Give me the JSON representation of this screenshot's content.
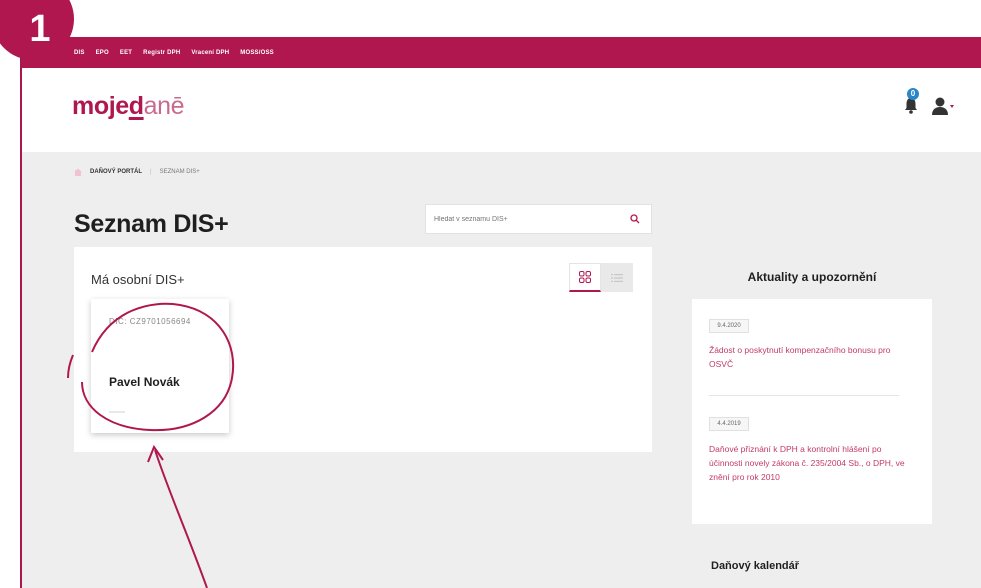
{
  "step_number": "1",
  "topbar": {
    "items": [
      "DIS",
      "EPO",
      "EET",
      "Registr DPH",
      "Vracení DPH",
      "MOSS/OSS"
    ]
  },
  "header": {
    "logo_part1": "moje",
    "logo_part2": "d",
    "logo_part3": "anē",
    "notification_count": "0"
  },
  "breadcrumb": {
    "home": "DAŇOVÝ PORTÁL",
    "separator": "|",
    "current": "SEZNAM DIS+"
  },
  "page_title": "Seznam DIS+",
  "search": {
    "placeholder": "Hledat v seznamu DIS+"
  },
  "panel": {
    "title": "Má osobní DIS+",
    "card": {
      "dic": "DIČ: CZ9701056694",
      "name": "Pavel Novák"
    }
  },
  "news": {
    "title": "Aktuality a upozornění",
    "items": [
      {
        "date": "9.4.2020",
        "text": "Žádost o poskytnutí kompenzačního bonusu pro OSVČ"
      },
      {
        "date": "4.4.2019",
        "text": "Daňové přiznání k DPH a kontrolní hlášení po účinnosti novely zákona č. 235/2004 Sb., o DPH, ve znění pro rok 2010"
      }
    ]
  },
  "calendar": {
    "title": "Daňový kalendář"
  },
  "colors": {
    "brand": "#b0174e",
    "link": "#c23a6a",
    "notification": "#2a86c8",
    "content_bg": "#eeeeee"
  },
  "icons": [
    "home-icon",
    "search-icon",
    "grid-view-icon",
    "list-view-icon",
    "bell-icon",
    "user-icon",
    "caret-down-icon"
  ]
}
